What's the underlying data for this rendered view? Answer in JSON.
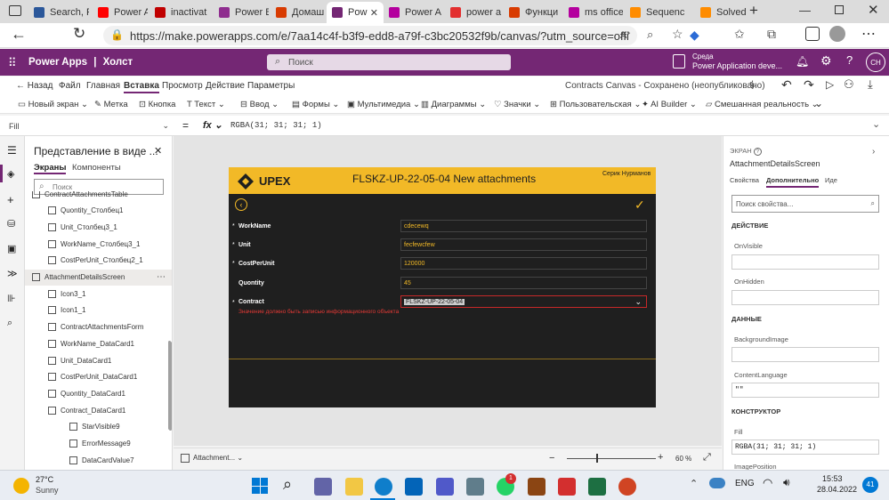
{
  "browser": {
    "tabs": [
      {
        "label": "Search, F",
        "color": "#2b579a"
      },
      {
        "label": "Power A",
        "color": "#ff0000"
      },
      {
        "label": "inactivat",
        "color": "#c00000"
      },
      {
        "label": "Power BI",
        "color": "#8f2d8f"
      },
      {
        "label": "Домашн",
        "color": "#d83b01"
      },
      {
        "label": "Pow",
        "color": "#742774"
      },
      {
        "label": "Power A",
        "color": "#b4009e"
      },
      {
        "label": "power a",
        "color": "#e22f2f"
      },
      {
        "label": "Функци",
        "color": "#d83b01"
      },
      {
        "label": "ms office",
        "color": "#b4009e"
      },
      {
        "label": "Sequenc",
        "color": "#ff8c00"
      },
      {
        "label": "Solved: F",
        "color": "#ff8c00"
      }
    ],
    "url": "https://make.powerapps.com/e/7aa14c4f-b3f9-edd8-a79f-c3bc20532f9b/canvas/?utm_source=office&utm_m..."
  },
  "header": {
    "app_name": "Power Apps",
    "separator": "|",
    "mode": "Холст",
    "search_placeholder": "Поиск",
    "env_label": "Среда",
    "env_name": "Power Application deve...",
    "avatar": "CH"
  },
  "menu": {
    "back": "Назад",
    "items": [
      "Файл",
      "Главная",
      "Вставка",
      "Просмотр",
      "Действие",
      "Параметры"
    ],
    "status": "Contracts Canvas - Сохранено (неопубликовано)"
  },
  "toolbar": {
    "items": [
      "Новый экран",
      "Метка",
      "Кнопка",
      "Текст",
      "Ввод",
      "Формы",
      "Мультимедиа",
      "Диаграммы",
      "Значки",
      "Пользовательская",
      "AI Builder",
      "Смешанная реальность"
    ]
  },
  "formula": {
    "property": "Fill",
    "fx": "fx",
    "value": "RGBA(31; 31; 31; 1)"
  },
  "tree": {
    "title": "Представление в виде ...",
    "tabs": [
      "Экраны",
      "Компоненты"
    ],
    "search_placeholder": "Поиск",
    "items": [
      {
        "label": "ContractAttachmentsTable",
        "indent": 0
      },
      {
        "label": "Quontity_Столбец1",
        "indent": 1
      },
      {
        "label": "Unit_Столбец3_1",
        "indent": 1
      },
      {
        "label": "WorkName_Столбец3_1",
        "indent": 1
      },
      {
        "label": "CostPerUnit_Столбец2_1",
        "indent": 1
      },
      {
        "label": "AttachmentDetailsScreen",
        "indent": 0
      },
      {
        "label": "Icon3_1",
        "indent": 1
      },
      {
        "label": "Icon1_1",
        "indent": 1
      },
      {
        "label": "ContractAttachmentsForm",
        "indent": 1
      },
      {
        "label": "WorkName_DataCard1",
        "indent": 2
      },
      {
        "label": "Unit_DataCard1",
        "indent": 2
      },
      {
        "label": "CostPerUnit_DataCard1",
        "indent": 2
      },
      {
        "label": "Quontity_DataCard1",
        "indent": 2
      },
      {
        "label": "Contract_DataCard1",
        "indent": 2
      },
      {
        "label": "StarVisible9",
        "indent": 3
      },
      {
        "label": "ErrorMessage9",
        "indent": 3
      },
      {
        "label": "DataCardValue7",
        "indent": 3
      }
    ]
  },
  "app_screen": {
    "logo": "UPEX",
    "title": "FLSKZ-UP-22-05-04 New attachments",
    "user": "Серик Нурманов",
    "fields": [
      {
        "label": "WorkName",
        "value": "cdecewq",
        "required": true
      },
      {
        "label": "Unit",
        "value": "fecfewcfew",
        "required": true
      },
      {
        "label": "CostPerUnit",
        "value": "120000",
        "required": true
      },
      {
        "label": "Quontity",
        "value": "45",
        "required": false
      }
    ],
    "contract": {
      "label": "Contract",
      "value": "FLSKZ-UP-22-05-04",
      "error": "Значение должно быть записью информационного объекта"
    }
  },
  "bottom": {
    "screen_name": "Attachment...",
    "zoom": "60",
    "zoom_unit": "%"
  },
  "props": {
    "type_label": "ЭКРАН",
    "screen_name": "AttachmentDetailsScreen",
    "tabs": [
      "Свойства",
      "Дополнительно",
      "Иде"
    ],
    "search_placeholder": "Поиск свойства...",
    "sections": {
      "action": "ДЕЙСТВИЕ",
      "data": "ДАННЫЕ",
      "designer": "КОНСТРУКТОР"
    },
    "onvisible": "OnVisible",
    "onhidden": "OnHidden",
    "bgimage": "BackgroundImage",
    "contentlang": "ContentLanguage",
    "contentlang_value": "\"\"",
    "fill": "Fill",
    "fill_value": "RGBA(31; 31; 31; 1)",
    "cut_label": "ImagePosition"
  },
  "taskbar": {
    "temp": "27°C",
    "weather": "Sunny",
    "lang": "ENG",
    "time": "15:53",
    "date": "28.04.2022",
    "notif": "41",
    "badge": "1"
  }
}
